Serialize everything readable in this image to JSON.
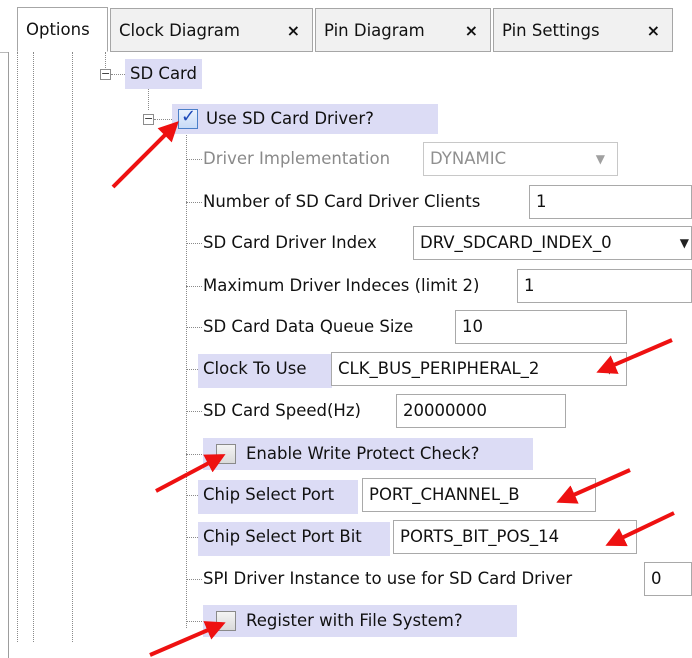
{
  "tabs": [
    {
      "label": "Options",
      "closable": false,
      "active": true
    },
    {
      "label": "Clock Diagram",
      "closable": true,
      "active": false
    },
    {
      "label": "Pin Diagram",
      "closable": true,
      "active": false
    },
    {
      "label": "Pin Settings",
      "closable": true,
      "active": false
    }
  ],
  "tab_close_glyph": "×",
  "tree": {
    "group_label": "SD Card",
    "use_driver": {
      "label": "Use SD Card Driver?",
      "checked": true
    },
    "driver_impl": {
      "label": "Driver Implementation",
      "value": "DYNAMIC"
    },
    "num_clients": {
      "label": "Number of SD Card Driver Clients",
      "value": "1"
    },
    "driver_index": {
      "label": "SD Card Driver Index",
      "value": "DRV_SDCARD_INDEX_0"
    },
    "max_indices": {
      "label": "Maximum Driver Indeces (limit 2)",
      "value": "1"
    },
    "queue_size": {
      "label": "SD Card Data Queue Size",
      "value": "10"
    },
    "clock": {
      "label": "Clock To Use",
      "value": "CLK_BUS_PERIPHERAL_2"
    },
    "speed": {
      "label": "SD Card Speed(Hz)",
      "value": "20000000"
    },
    "write_protect": {
      "label": "Enable Write Protect Check?",
      "checked": false
    },
    "cs_port": {
      "label": "Chip Select Port",
      "value": "PORT_CHANNEL_B"
    },
    "cs_port_bit": {
      "label": "Chip Select Port Bit",
      "value": "PORTS_BIT_POS_14"
    },
    "spi_instance": {
      "label": "SPI Driver Instance to use for SD Card Driver",
      "value": "0"
    },
    "register_fs": {
      "label": "Register with File System?",
      "checked": false
    }
  },
  "colors": {
    "selection": "#dcdcf5",
    "annotation_arrow": "#ee1111"
  },
  "icons": {
    "expander": "minus-box-icon",
    "dropdown": "caret-down-icon",
    "check": "checkmark-icon"
  }
}
